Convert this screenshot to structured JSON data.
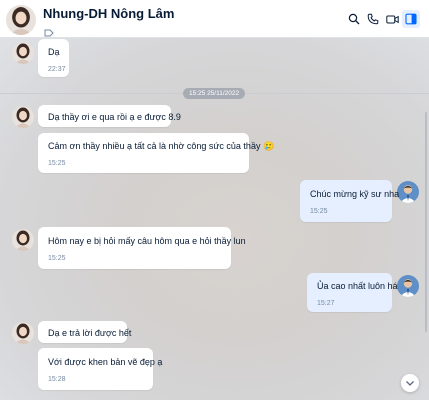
{
  "header": {
    "contact_name": "Nhung-DH Nông Lâm",
    "icons": [
      "search-icon",
      "phone-icon",
      "video-call-icon",
      "sidebar-toggle-icon"
    ],
    "accent_color": "#0068ff"
  },
  "date_separator": "15:25 25/11/2022",
  "messages": [
    {
      "sender": "contact",
      "text": "Dạ",
      "time": "22:37"
    },
    {
      "sender": "contact",
      "text": "Dạ thầy ơi e qua rồi ạ e được 8.9",
      "time": ""
    },
    {
      "sender": "contact",
      "text": "Cảm ơn thầy nhiều ạ tất cả là nhờ công sức của thầy 🥲",
      "time": "15:25"
    },
    {
      "sender": "me",
      "text": "Chúc mừng kỹ sư nha",
      "time": "15:25"
    },
    {
      "sender": "contact",
      "text": "Hôm nay e bị hỏi mấy câu hôm qua e hỏi thầy lun",
      "time": "15:25"
    },
    {
      "sender": "me",
      "text": "Ủa cao nhất luôn há",
      "time": "15:27"
    },
    {
      "sender": "contact",
      "text": "Dạ e trả lời được hết",
      "time": ""
    },
    {
      "sender": "contact",
      "text": "Với được khen bản vẽ đẹp ạ",
      "time": "15:28"
    }
  ]
}
